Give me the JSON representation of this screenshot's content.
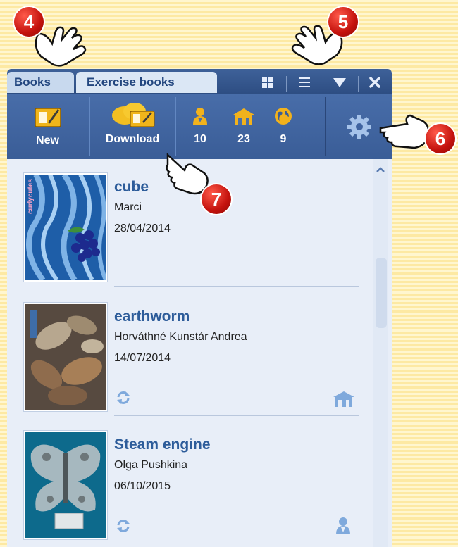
{
  "tabs": {
    "books_label": "Books",
    "exercise_label": "Exercise books"
  },
  "view_controls": {
    "grid_icon": "grid-icon",
    "list_icon": "list-icon",
    "dropdown_icon": "triangle-down-icon",
    "close_icon": "close-icon"
  },
  "toolbar": {
    "new_label": "New",
    "download_label": "Download",
    "stats": [
      {
        "icon": "person-icon",
        "value": "10"
      },
      {
        "icon": "house-icon",
        "value": "23"
      },
      {
        "icon": "globe-icon",
        "value": "9"
      }
    ],
    "settings_icon": "gear-icon"
  },
  "books": [
    {
      "title": "cube",
      "author": "Marci",
      "date": "28/04/2014",
      "cover_text": "curlycutes"
    },
    {
      "title": "earthworm",
      "author": "Horváthné Kunstár Andrea",
      "date": "14/07/2014"
    },
    {
      "title": "Steam engine",
      "author": "Olga Pushkina",
      "date": "06/10/2015"
    }
  ],
  "callouts": [
    "4",
    "5",
    "6",
    "7"
  ],
  "colors": {
    "header_blue": "#2d4d82",
    "title_blue": "#2d5c9a",
    "callout_red": "#c4120d"
  }
}
